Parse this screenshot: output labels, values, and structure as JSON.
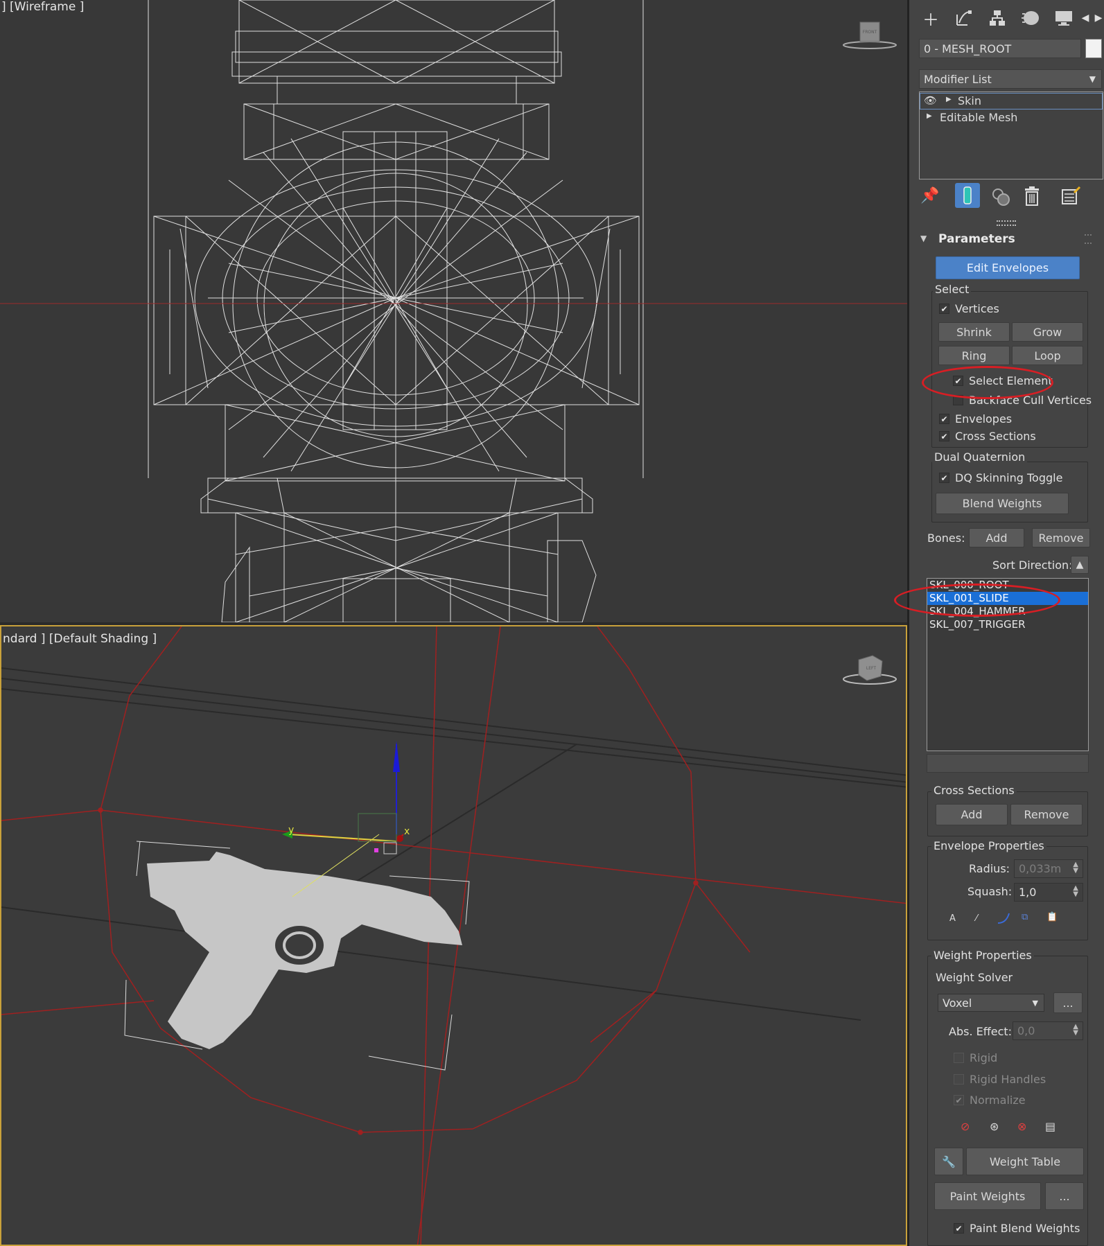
{
  "viewports": {
    "top_label": "] [Wireframe ]",
    "persp_label": "ndard ] [Default Shading ]",
    "top_cube_label": "FRONT",
    "persp_cube_label": "LEFT",
    "gizmo_x": "x",
    "gizmo_y": "y"
  },
  "toolbar": {
    "icons": [
      "create-icon",
      "modify-icon",
      "hierarchy-icon",
      "motion-icon",
      "display-icon",
      "arrow-left-icon",
      "arrow-right-icon"
    ]
  },
  "object_name": "0 - MESH_ROOT",
  "modifier_list": {
    "label": "Modifier List",
    "stack": [
      {
        "name": "Skin",
        "active": true
      },
      {
        "name": "Editable Mesh",
        "active": false
      }
    ]
  },
  "parameters": {
    "title": "Parameters",
    "edit_envelopes": "Edit Envelopes",
    "select": {
      "title": "Select",
      "vertices": {
        "label": "Vertices",
        "checked": true
      },
      "shrink": "Shrink",
      "grow": "Grow",
      "ring": "Ring",
      "loop": "Loop",
      "select_element": {
        "label": "Select Element",
        "checked": true
      },
      "backface_cull": {
        "label": "Backface Cull Vertices",
        "checked": false
      },
      "envelopes": {
        "label": "Envelopes",
        "checked": true
      },
      "cross_sections": {
        "label": "Cross Sections",
        "checked": true
      }
    },
    "dual_quaternion": {
      "title": "Dual Quaternion",
      "dq_toggle": {
        "label": "DQ Skinning Toggle",
        "checked": true
      },
      "blend_weights": "Blend Weights"
    },
    "bones": {
      "label": "Bones:",
      "add": "Add",
      "remove": "Remove",
      "sort_direction": "Sort Direction:",
      "list": [
        {
          "name": "SKL_000_ROOT",
          "selected": false
        },
        {
          "name": "SKL_001_SLIDE",
          "selected": true
        },
        {
          "name": "SKL_004_HAMMER",
          "selected": false
        },
        {
          "name": "SKL_007_TRIGGER",
          "selected": false
        }
      ]
    },
    "cross_sections": {
      "title": "Cross Sections",
      "add": "Add",
      "remove": "Remove"
    },
    "envelope_properties": {
      "title": "Envelope Properties",
      "radius_label": "Radius:",
      "radius_value": "0,033m",
      "squash_label": "Squash:",
      "squash_value": "1,0"
    },
    "weight_properties": {
      "title": "Weight Properties",
      "solver_label": "Weight Solver",
      "solver_value": "Voxel",
      "solver_more": "...",
      "abs_effect_label": "Abs. Effect:",
      "abs_effect_value": "0,0",
      "rigid": {
        "label": "Rigid",
        "checked": false
      },
      "rigid_handles": {
        "label": "Rigid Handles",
        "checked": false
      },
      "normalize": {
        "label": "Normalize",
        "checked": true
      },
      "weight_table": "Weight Table",
      "paint_weights": "Paint Weights",
      "paint_more": "...",
      "paint_blend": {
        "label": "Paint Blend Weights",
        "checked": true
      }
    }
  },
  "colors": {
    "accent_blue": "#4b82c8",
    "selection_blue": "#1a6fd6",
    "annotation_red": "#d81e24",
    "viewport_active_border": "#c9a13a"
  }
}
